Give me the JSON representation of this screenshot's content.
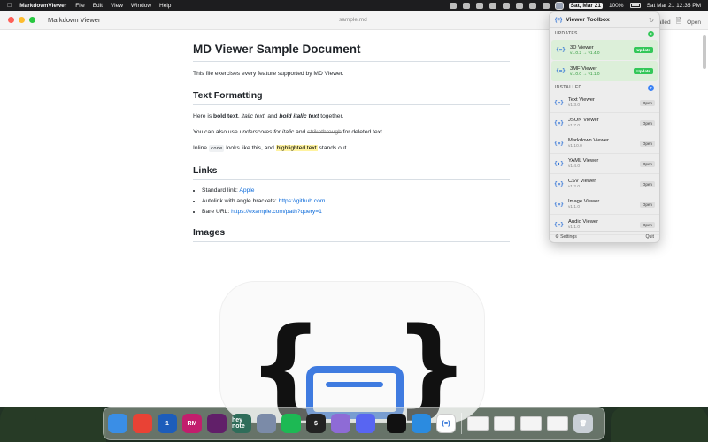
{
  "menubar": {
    "app_name": "MarkdownViewer",
    "menus": [
      "File",
      "Edit",
      "View",
      "Window",
      "Help"
    ],
    "date_badge": "Sat, Mar 21",
    "battery": "100%",
    "clock": "Sat Mar 21  12:35 PM"
  },
  "window": {
    "title": "Markdown Viewer",
    "doc_name": "sample.md",
    "right_label": "Open",
    "partial_label": "talled"
  },
  "document": {
    "h1": "MD Viewer Sample Document",
    "intro": "This file exercises every feature supported by MD Viewer.",
    "h2_formatting": "Text Formatting",
    "p1": {
      "a": "Here is ",
      "bold": "bold text",
      "b": ", ",
      "italic": "italic text",
      "c": ", and ",
      "bold_italic": "bold italic text",
      "d": " together."
    },
    "p2": {
      "a": "You can also use ",
      "underscore": "underscores for italic",
      "b": " and ",
      "strike": "strikethrough",
      "c": " for deleted text."
    },
    "p3": {
      "a": "Inline ",
      "code": "code",
      "b": " looks like this, and ",
      "highlight": "highlighted text",
      "c": " stands out."
    },
    "h2_links": "Links",
    "links": [
      {
        "label": "Standard link: ",
        "link": "Apple"
      },
      {
        "label": "Autolink with angle brackets: ",
        "link": "https://github.com"
      },
      {
        "label": "Bare URL: ",
        "link": "https://example.com/path?query=1"
      }
    ],
    "h2_images": "Images"
  },
  "toolbox": {
    "title": "Viewer Toolbox",
    "logo": "{=}",
    "updates_header": "UPDATES",
    "updates_count": "2",
    "installed_header": "INSTALLED",
    "installed_count": "7",
    "updates": [
      {
        "name": "3D Viewer",
        "version": "v1.0.2 → v1.4.0",
        "button": "Update"
      },
      {
        "name": "3MF Viewer",
        "version": "v1.0.0 → v1.1.0",
        "button": "Update"
      }
    ],
    "installed": [
      {
        "name": "Text Viewer",
        "version": "v1.3.0",
        "button": "Open"
      },
      {
        "name": "JSON Viewer",
        "version": "v1.7.0",
        "button": "Open"
      },
      {
        "name": "Markdown Viewer",
        "version": "v1.10.0",
        "button": "Open"
      },
      {
        "name": "YAML Viewer",
        "version": "v1.4.0",
        "button": "Open"
      },
      {
        "name": "CSV Viewer",
        "version": "v1.2.0",
        "button": "Open"
      },
      {
        "name": "Image Viewer",
        "version": "v1.1.0",
        "button": "Open"
      },
      {
        "name": "Audio Viewer",
        "version": "v1.1.0",
        "button": "Open"
      }
    ],
    "settings_label": "Settings",
    "quit_label": "Quit"
  },
  "dock": {
    "apps": [
      {
        "name": "finder",
        "label": "",
        "color": "#3a8ee6"
      },
      {
        "name": "chrome",
        "label": "",
        "color": "#e94235"
      },
      {
        "name": "1password",
        "label": "1",
        "color": "#1d5dbb"
      },
      {
        "name": "rubymine",
        "label": "RM",
        "color": "#c21e6d"
      },
      {
        "name": "slack",
        "label": "",
        "color": "#611f69"
      },
      {
        "name": "hey-notes",
        "label": "hey note",
        "color": "#2f6d5a"
      },
      {
        "name": "preview",
        "label": "",
        "color": "#7b8ba8"
      },
      {
        "name": "spotify",
        "label": "",
        "color": "#1db954"
      },
      {
        "name": "terminal",
        "label": "$",
        "color": "#222222"
      },
      {
        "name": "orb",
        "label": "",
        "color": "#8e6bd6"
      },
      {
        "name": "discord",
        "label": "",
        "color": "#5865f2"
      },
      {
        "name": "chatgpt",
        "label": "",
        "color": "#111111"
      },
      {
        "name": "xcode-tool",
        "label": "",
        "color": "#2b8be0"
      },
      {
        "name": "viewer-toolbox",
        "label": "{=}",
        "color": "#ffffff"
      }
    ]
  }
}
